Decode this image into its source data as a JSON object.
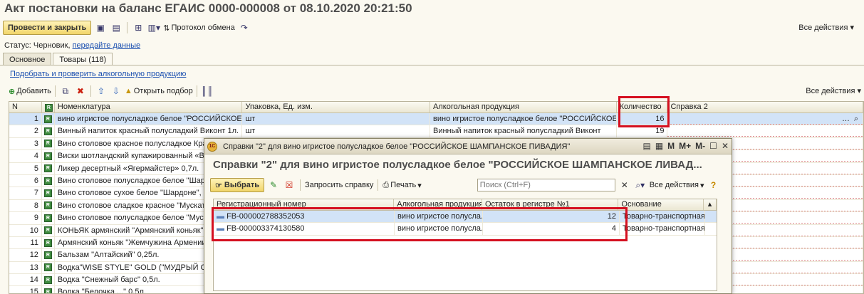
{
  "title": "Акт постановки на баланс ЕГАИС 0000-000008 от 08.10.2020 20:21:50",
  "toolbar": {
    "post_close": "Провести и закрыть",
    "exchange_protocol": "Протокол обмена",
    "all_actions": "Все действия"
  },
  "status": {
    "label": "Статус: Черновик,",
    "link": "передайте данные"
  },
  "tabs": [
    {
      "label": "Основное"
    },
    {
      "label": "Товары (118)"
    }
  ],
  "select_link": "Подобрать и проверить алкогольную продукцию",
  "toolbar2": {
    "add": "Добавить",
    "open_selection": "Открыть подбор",
    "all_actions": "Все действия"
  },
  "columns": {
    "n": "N",
    "nom": "Номенклатура",
    "pack": "Упаковка, Ед. изм.",
    "alc": "Алкогольная продукция",
    "qty": "Количество",
    "sp": "Справка 2"
  },
  "rows": [
    {
      "n": "1",
      "nom": "вино игристое полусладкое белое \"РОССИЙСКОЕ ...",
      "pack": "шт",
      "alc": "вино игристое полусладкое белое \"РОССИЙСКОЕ ...",
      "qty": "16"
    },
    {
      "n": "2",
      "nom": "Винный напиток красный полусладкий Виконт 1л.",
      "pack": "шт",
      "alc": "Винный напиток красный полусладкий Виконт",
      "qty": "19"
    },
    {
      "n": "3",
      "nom": "Вино столовое красное полусладкое Крас",
      "pack": "",
      "alc": "",
      "qty": ""
    },
    {
      "n": "4",
      "nom": "Виски шотландский купажированный «Ви",
      "pack": "",
      "alc": "",
      "qty": ""
    },
    {
      "n": "5",
      "nom": "Ликер десертный «Ягермайстер» 0,7л.",
      "pack": "",
      "alc": "",
      "qty": ""
    },
    {
      "n": "6",
      "nom": "Вино столовое полусладкое белое \"Шард",
      "pack": "",
      "alc": "",
      "qty": ""
    },
    {
      "n": "7",
      "nom": "Вино столовое сухое белое \"Шардоне\", \"В",
      "pack": "",
      "alc": "",
      "qty": ""
    },
    {
      "n": "8",
      "nom": "Вино столовое сладкое красное \"Мускат",
      "pack": "",
      "alc": "",
      "qty": ""
    },
    {
      "n": "9",
      "nom": "Вино столовое полусладкое белое \"Муска",
      "pack": "",
      "alc": "",
      "qty": ""
    },
    {
      "n": "10",
      "nom": "КОНЬЯК армянский \"Армянский коньяк\"",
      "pack": "",
      "alc": "",
      "qty": ""
    },
    {
      "n": "11",
      "nom": "Армянский коньяк \"Жемчужина Армении",
      "pack": "",
      "alc": "",
      "qty": ""
    },
    {
      "n": "12",
      "nom": "Бальзам \"Алтайский\" 0,25л.",
      "pack": "",
      "alc": "",
      "qty": ""
    },
    {
      "n": "13",
      "nom": "Водка\"WISE STYLE\" GOLD (\"МУДРЫЙ СТ",
      "pack": "",
      "alc": "",
      "qty": ""
    },
    {
      "n": "14",
      "nom": "Водка \"Снежный барс\" 0,5л.",
      "pack": "",
      "alc": "",
      "qty": ""
    },
    {
      "n": "15",
      "nom": "Водка \"Белочка ...\" 0,5л.",
      "pack": "",
      "alc": "",
      "qty": ""
    }
  ],
  "dialog": {
    "window_title": "Справки \"2\" для вино игристое полусладкое белое \"РОССИЙСКОЕ ШАМПАНСКОЕ ПИВАДИЯ\"",
    "heading": "Справки \"2\" для вино игристое полусладкое белое \"РОССИЙСКОЕ ШАМПАНСКОЕ ЛИВАД...",
    "select": "Выбрать",
    "request": "Запросить справку",
    "print": "Печать",
    "search_placeholder": "Поиск (Ctrl+F)",
    "all_actions": "Все действия",
    "columns": {
      "reg": "Регистрационный номер",
      "alc": "Алкогольная продукция",
      "ost": "Остаток в регистре №1",
      "osn": "Основание"
    },
    "rows": [
      {
        "reg": "FB-000002788352053",
        "alc": "вино игристое полусла...",
        "ost": "12",
        "osn": "Товарно-транспортная..."
      },
      {
        "reg": "FB-000003374130580",
        "alc": "вино игристое полусла...",
        "ost": "4",
        "osn": "Товарно-транспортная..."
      }
    ]
  }
}
